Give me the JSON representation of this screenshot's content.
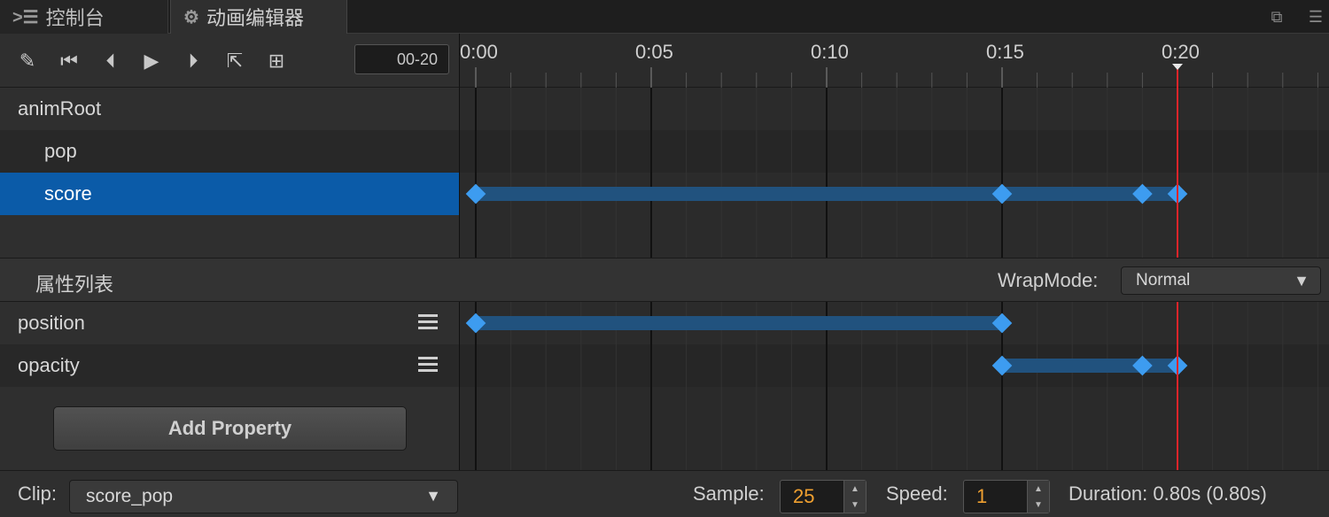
{
  "tabs": [
    {
      "label": "控制台",
      "icon": "console-icon"
    },
    {
      "label": "动画编辑器",
      "icon": "animation-editor-icon"
    }
  ],
  "toolbar": {
    "buttons": [
      "edit-icon",
      "jump-first-icon",
      "prev-frame-icon",
      "play-icon",
      "next-frame-icon",
      "open-external-icon",
      "add-event-icon"
    ],
    "frame_value": "00-20"
  },
  "timeline": {
    "tick_labels": [
      "0:00",
      "0:05",
      "0:10",
      "0:15",
      "0:20"
    ],
    "current_frame": 20,
    "frames_per_major": 5,
    "visible_frames": 24
  },
  "nodes": [
    {
      "name": "animRoot",
      "level": 0,
      "selected": false
    },
    {
      "name": "pop",
      "level": 1,
      "selected": false
    },
    {
      "name": "score",
      "level": 1,
      "selected": true
    }
  ],
  "node_keyframes": {
    "score": [
      0,
      15,
      19,
      20
    ]
  },
  "properties": {
    "title": "属性列表",
    "wrapmode_label": "WrapMode:",
    "wrapmode_value": "Normal",
    "items": [
      {
        "name": "position",
        "keyframes": [
          0,
          15
        ]
      },
      {
        "name": "opacity",
        "keyframes": [
          15,
          19,
          20
        ]
      }
    ],
    "add_label": "Add Property"
  },
  "footer": {
    "clip_label": "Clip:",
    "clip_value": "score_pop",
    "sample_label": "Sample:",
    "sample_value": "25",
    "speed_label": "Speed:",
    "speed_value": "1",
    "duration_text": "Duration: 0.80s (0.80s)"
  },
  "colors": {
    "selected_row": "#0b5ba8",
    "keyframe": "#3d9cf0",
    "keyframe_bar": "#21527e",
    "playhead": "#e0242a",
    "sample_text": "#f0a030"
  }
}
